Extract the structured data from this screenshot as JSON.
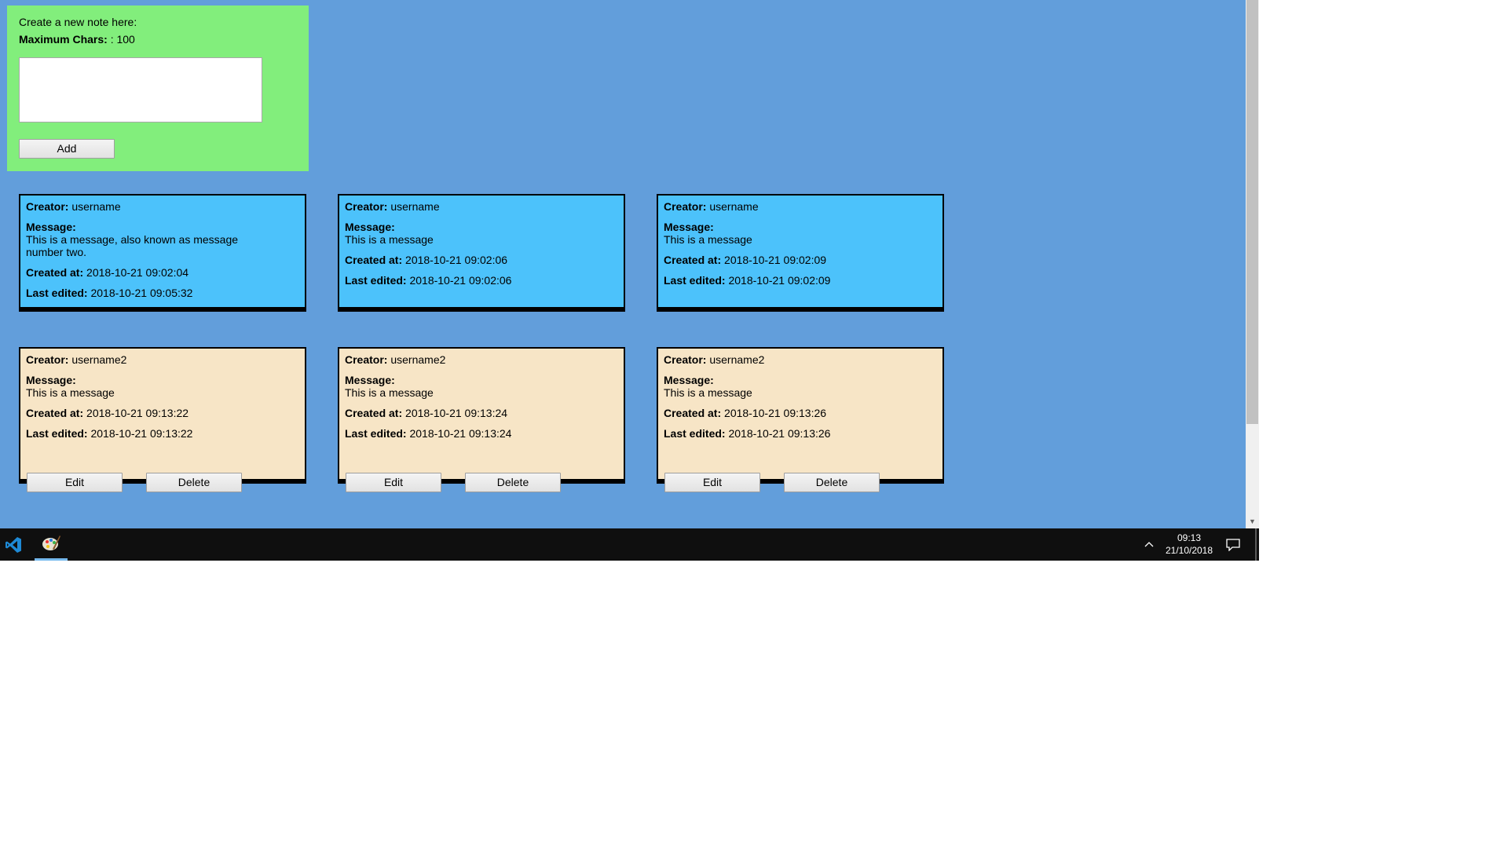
{
  "new_note": {
    "prompt": "Create a new note here:",
    "max_label": "Maximum Chars:",
    "max_value": " : 100",
    "input_value": "",
    "add_label": "Add"
  },
  "labels": {
    "creator": "Creator:",
    "message": "Message:",
    "created": "Created at:",
    "edited": "Last edited:",
    "edit": "Edit",
    "delete": "Delete"
  },
  "notes": [
    {
      "creator": "username",
      "message": "This is a message, also known as message number two.",
      "created": "2018-10-21 09:02:04",
      "edited": "2018-10-21 09:05:32"
    },
    {
      "creator": "username",
      "message": "This is a message",
      "created": "2018-10-21 09:02:06",
      "edited": "2018-10-21 09:02:06"
    },
    {
      "creator": "username",
      "message": "This is a message",
      "created": "2018-10-21 09:02:09",
      "edited": "2018-10-21 09:02:09"
    },
    {
      "creator": "username2",
      "message": "This is a message",
      "created": "2018-10-21 09:13:22",
      "edited": "2018-10-21 09:13:22"
    },
    {
      "creator": "username2",
      "message": "This is a message",
      "created": "2018-10-21 09:13:24",
      "edited": "2018-10-21 09:13:24"
    },
    {
      "creator": "username2",
      "message": "This is a message",
      "created": "2018-10-21 09:13:26",
      "edited": "2018-10-21 09:13:26"
    }
  ],
  "taskbar": {
    "time": "09:13",
    "date": "21/10/2018",
    "icons": [
      "vscode-icon",
      "paint-icon",
      "chevron-up-icon",
      "notification-icon"
    ]
  },
  "colors": {
    "page_bg": "#629edb",
    "new_note_bg": "#82ee7c",
    "note_blue": "#4cc2fb",
    "note_tan": "#f7e5c6",
    "taskbar": "#0f0f0f"
  }
}
